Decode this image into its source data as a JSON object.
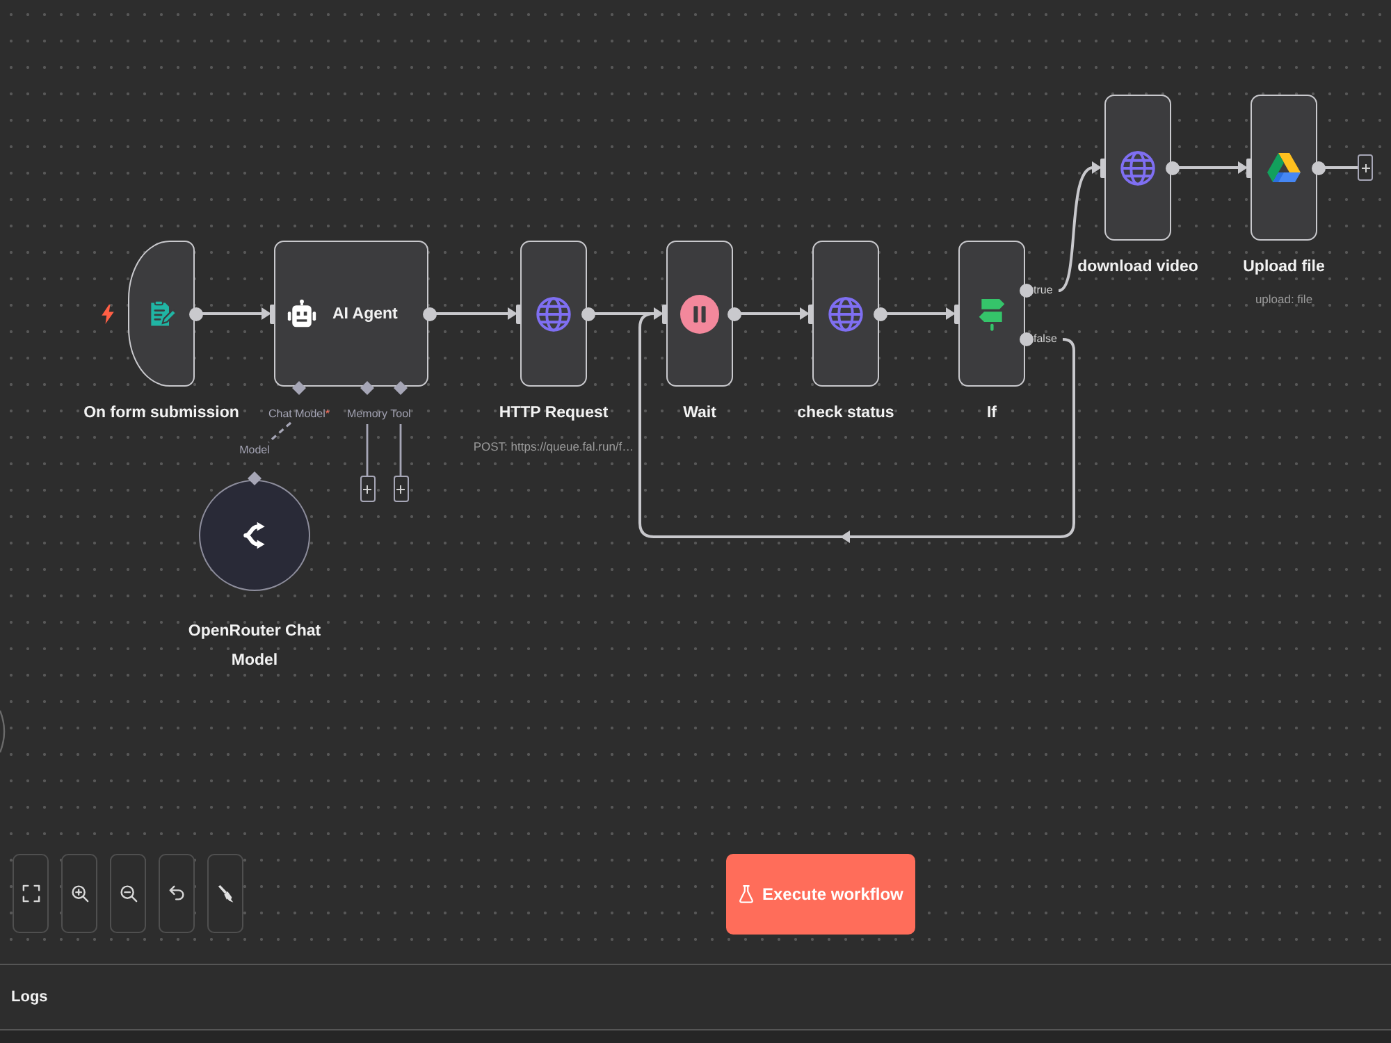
{
  "nodes": [
    {
      "kind": "trigger",
      "label": "On form submission"
    },
    {
      "kind": "agent",
      "label": "AI Agent",
      "ports": [
        {
          "label": "Chat Model",
          "mark": "*"
        },
        {
          "label": "Memory"
        },
        {
          "label": "Tool"
        }
      ]
    },
    {
      "kind": "model",
      "label": "OpenRouter Chat Model",
      "port": "Model"
    },
    {
      "kind": "http",
      "label": "HTTP Request",
      "subtitle": "POST: https://queue.fal.run/f…"
    },
    {
      "kind": "wait",
      "label": "Wait"
    },
    {
      "kind": "http",
      "label": "check status"
    },
    {
      "kind": "condition",
      "label": "If",
      "outputs": [
        "true",
        "false"
      ]
    },
    {
      "kind": "http",
      "label": "download video"
    },
    {
      "kind": "drive",
      "label": "Upload file",
      "subtitle": "upload: file"
    }
  ],
  "execute_button": "Execute workflow",
  "logs_panel": {
    "title": "Logs"
  }
}
